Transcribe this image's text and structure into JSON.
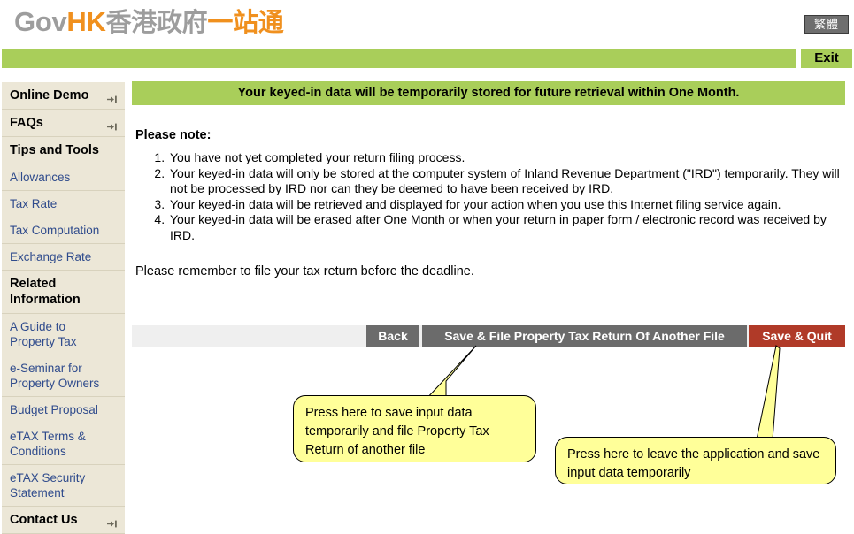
{
  "header": {
    "logo_gov": "Gov",
    "logo_hk": "HK",
    "logo_cn_gray": "香港政府",
    "logo_cn_orange": "一站通",
    "language_toggle": "繁體",
    "exit_label": "Exit"
  },
  "sidebar": {
    "items": [
      {
        "label": "Online Demo",
        "style": "head",
        "icon": "arrow-right-bar-icon",
        "has_icon": true
      },
      {
        "label": "FAQs",
        "style": "head",
        "icon": "arrow-right-bar-icon",
        "has_icon": true
      },
      {
        "label": "Tips and Tools",
        "style": "head",
        "has_icon": false
      },
      {
        "label": "Allowances",
        "style": "link",
        "has_icon": false
      },
      {
        "label": "Tax Rate",
        "style": "link",
        "has_icon": false
      },
      {
        "label": "Tax Computation",
        "style": "link",
        "has_icon": false
      },
      {
        "label": "Exchange Rate",
        "style": "link",
        "has_icon": false
      },
      {
        "label": "Related Information",
        "style": "head",
        "has_icon": false
      },
      {
        "label": "A Guide to Property Tax",
        "style": "link",
        "has_icon": false
      },
      {
        "label": "e-Seminar for Property Owners",
        "style": "link",
        "has_icon": false
      },
      {
        "label": "Budget Proposal",
        "style": "link",
        "has_icon": false
      },
      {
        "label": "eTAX Terms & Conditions",
        "style": "link",
        "has_icon": false
      },
      {
        "label": "eTAX Security Statement",
        "style": "link",
        "has_icon": false
      },
      {
        "label": "Contact Us",
        "style": "head",
        "icon": "arrow-right-bar-icon",
        "has_icon": true
      }
    ]
  },
  "main": {
    "notice_banner": "Your keyed-in data will be temporarily stored for future retrieval within One Month.",
    "please_note_label": "Please note:",
    "notes": [
      "You have not yet completed your return filing process.",
      "Your keyed-in data will only be stored at the computer system of Inland Revenue Department (\"IRD\") temporarily. They will not be processed by IRD nor can they be deemed to have been received by IRD.",
      "Your keyed-in data will be retrieved and displayed for your action when you use this Internet filing service again.",
      "Your keyed-in data will be erased after One Month or when your return in paper form / electronic record was received by IRD."
    ],
    "remember_text": "Please remember to file your tax return before the deadline."
  },
  "buttons": {
    "back": "Back",
    "save_and_file": "Save & File Property Tax Return Of Another File",
    "save_and_quit": "Save & Quit"
  },
  "callouts": {
    "left": "Press here to save input data temporarily and file Property Tax Return of another file",
    "right": "Press here to leave the application and save input data temporarily"
  },
  "colors": {
    "brand_green": "#a9ce5a",
    "brand_orange": "#f0901e",
    "brand_gray": "#9d9d9d",
    "sidebar_bg": "#ece7d7",
    "link_blue": "#2f4b8c",
    "button_gray": "#6b6b6b",
    "button_red": "#b03a28",
    "callout_yellow": "#ffff99"
  }
}
